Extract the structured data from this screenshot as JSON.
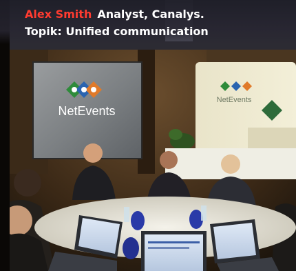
{
  "caption": {
    "name": "Alex Smith",
    "role": "Analyst, Canalys.",
    "topic": "Topik: Unified communication"
  },
  "screen": {
    "logo_text": "NetEvents"
  },
  "banner": {
    "logo_text": "NetEvents"
  },
  "colors": {
    "name_highlight": "#ff3b30",
    "caption_text": "#ffffff",
    "logo_green": "#2e8b3a",
    "logo_blue": "#2a64b0",
    "logo_orange": "#e07a2a"
  }
}
